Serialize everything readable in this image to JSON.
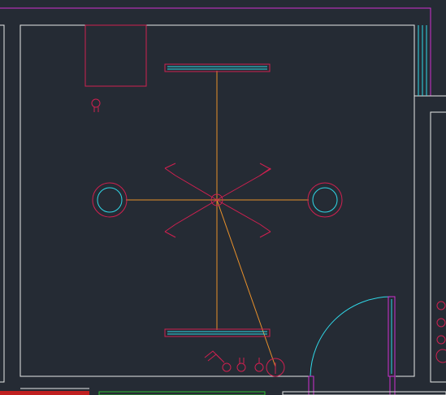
{
  "drawing": {
    "background": "#252b34",
    "colors": {
      "wall": "#e8e8e8",
      "magenta": "#d030d0",
      "cyan": "#30d8e8",
      "fixture": "#d02050",
      "wire": "#e8902a",
      "green": "#30c030",
      "red": "#c02020"
    }
  },
  "symbols": [
    {
      "name": "ceiling-light-center",
      "icon": "ceiling-light-icon"
    },
    {
      "name": "wall-lamp-left",
      "icon": "wall-lamp-icon"
    },
    {
      "name": "wall-lamp-right",
      "icon": "wall-lamp-icon"
    },
    {
      "name": "fluorescent-top",
      "icon": "fluorescent-lamp-icon"
    },
    {
      "name": "fluorescent-bottom",
      "icon": "fluorescent-lamp-icon"
    },
    {
      "name": "switch-group",
      "icon": "light-switch-icon"
    },
    {
      "name": "socket-box",
      "icon": "electrical-panel-icon"
    },
    {
      "name": "door",
      "icon": "door-swing-icon"
    }
  ]
}
